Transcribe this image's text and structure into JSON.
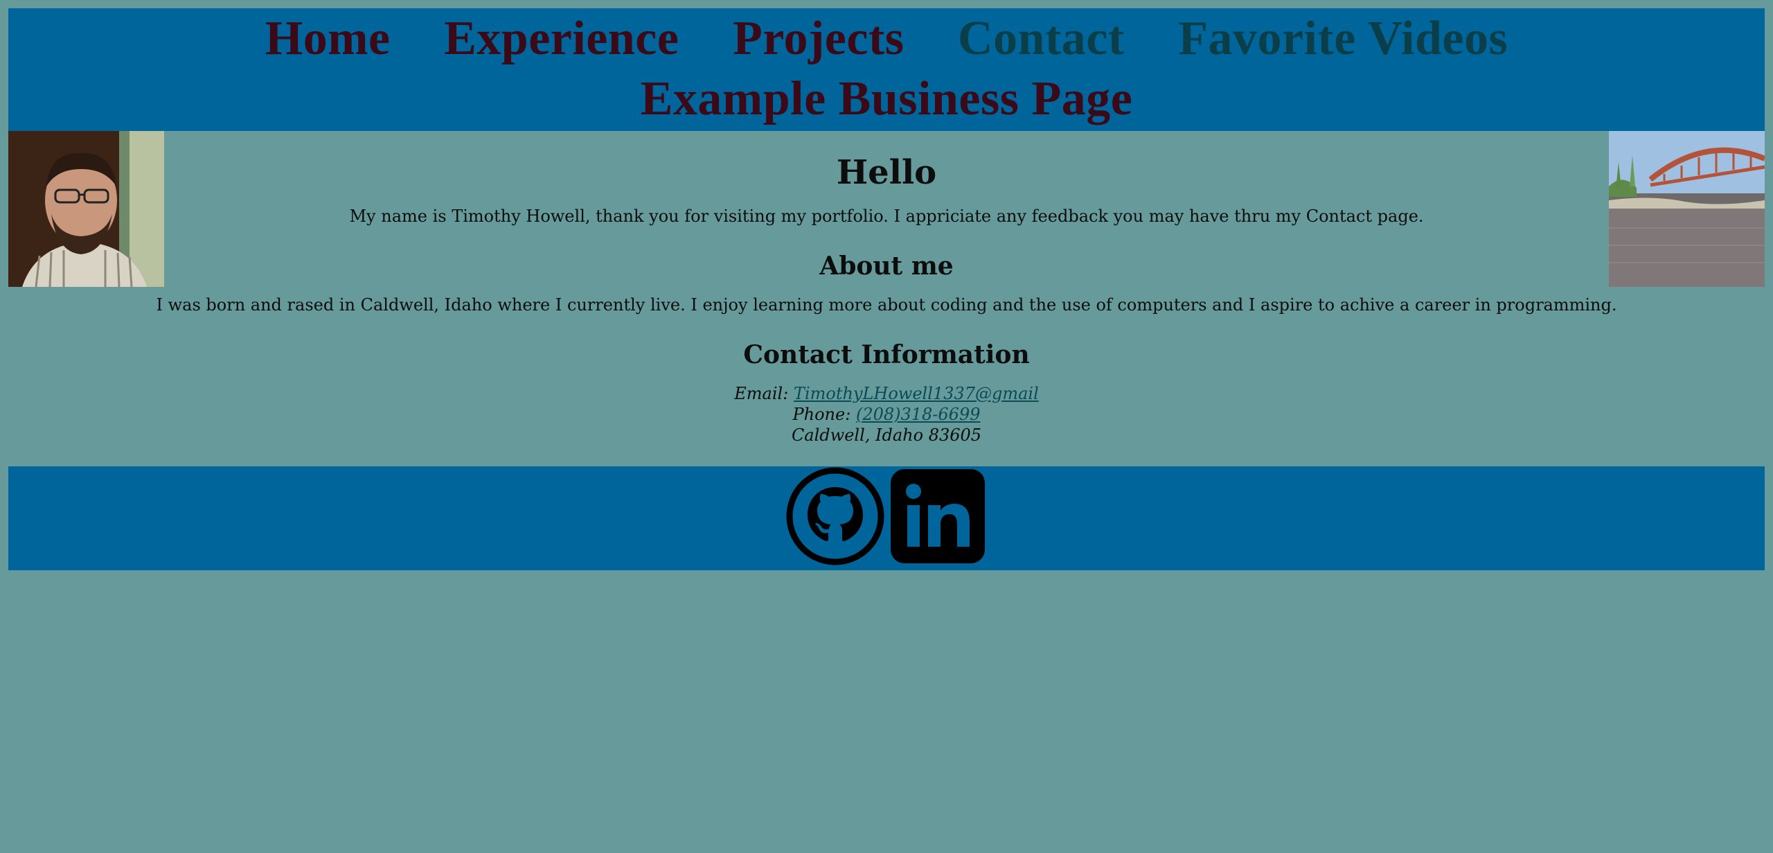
{
  "nav": {
    "items": [
      {
        "label": "Home",
        "dim": false
      },
      {
        "label": "Experience",
        "dim": false
      },
      {
        "label": "Projects",
        "dim": false
      },
      {
        "label": "Contact",
        "dim": true
      },
      {
        "label": "Favorite Videos",
        "dim": true
      },
      {
        "label": "Example Business Page",
        "dim": false
      }
    ]
  },
  "hero": {
    "title": "Hello",
    "intro": "My name is Timothy Howell, thank you for visiting my portfolio. I appriciate any feedback you may have thru my Contact page."
  },
  "about": {
    "heading": "About me",
    "text": "I was born and rased in Caldwell, Idaho where I currently live. I enjoy learning more about coding and the use of computers and I aspire to achive a career in programming."
  },
  "contact": {
    "heading": "Contact Information",
    "email_label": "Email:",
    "email": "TimothyLHowell1337@gmail",
    "phone_label": "Phone:",
    "phone": "(208)318-6699",
    "address": "Caldwell, Idaho 83605"
  },
  "footer": {
    "icons": [
      "github-icon",
      "linkedin-icon"
    ]
  },
  "colors": {
    "page_bg": "#679a9a",
    "banner": "#00659a",
    "nav_text": "#3a0a18",
    "nav_text_dim": "#0a3f4a"
  }
}
